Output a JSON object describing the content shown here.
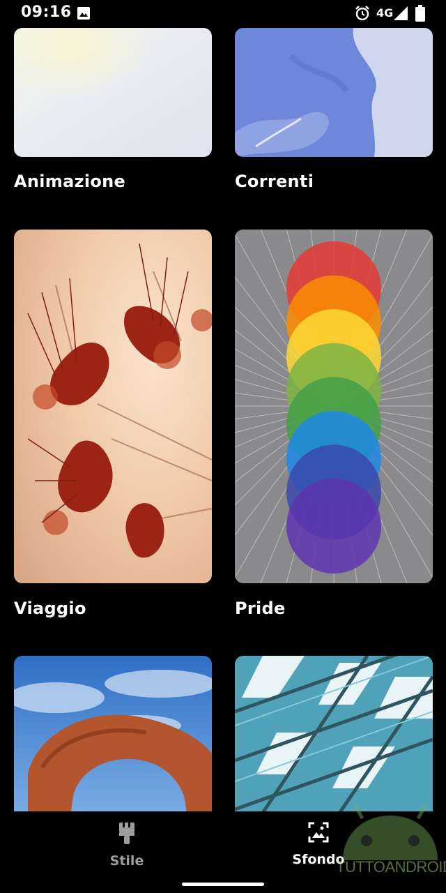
{
  "status_bar": {
    "time": "09:16",
    "network": "4G",
    "icons": [
      "image-icon",
      "alarm-icon",
      "signal-icon",
      "battery-icon"
    ]
  },
  "wallpapers": [
    {
      "label": "Animazione"
    },
    {
      "label": "Correnti"
    },
    {
      "label": "Viaggio"
    },
    {
      "label": "Pride"
    },
    {
      "label": "",
      "description_icon": "landscape-arch"
    },
    {
      "label": "",
      "description_icon": "architecture-glass"
    }
  ],
  "bottom_nav": {
    "items": [
      {
        "label": "Stile",
        "icon": "brush-icon",
        "selected": false
      },
      {
        "label": "Sfondo",
        "icon": "wallpaper-icon",
        "selected": true
      }
    ]
  },
  "watermark": {
    "text": "TUTTOANDROID"
  },
  "colors": {
    "background": "#000000",
    "nav_inactive": "#9e9e9e",
    "nav_active": "#ffffff",
    "pride": [
      "#e53935",
      "#fb8c00",
      "#fdd835",
      "#7cb342",
      "#43a047",
      "#1e88e5",
      "#3949ab",
      "#5e35b1"
    ]
  }
}
